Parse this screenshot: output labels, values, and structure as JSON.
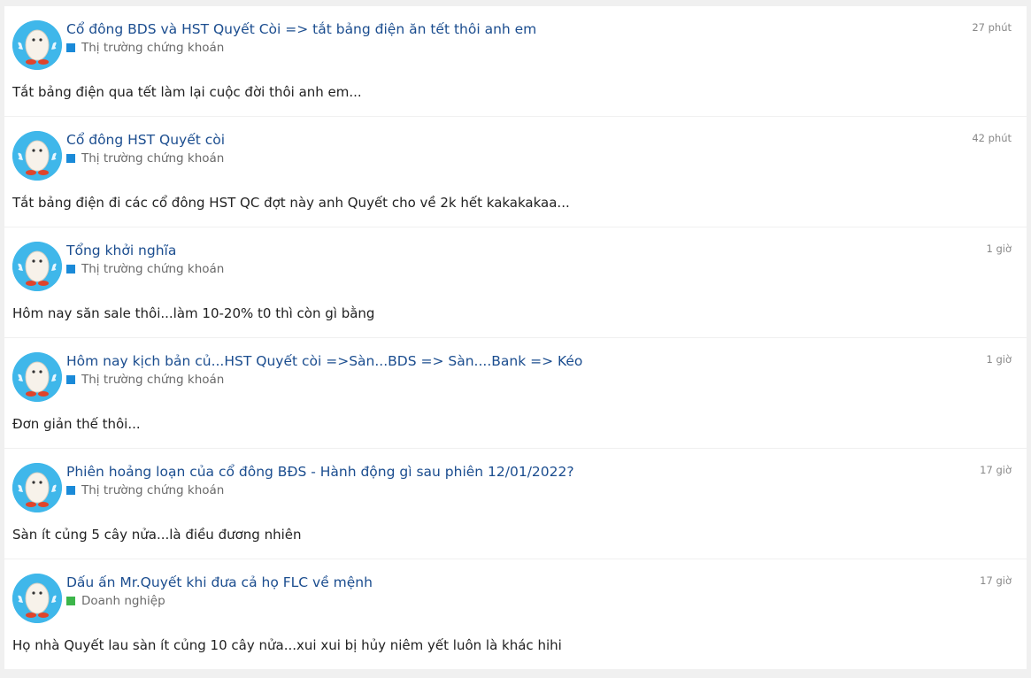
{
  "posts": [
    {
      "title": "Cổ đông BDS và HST Quyết Còi => tắt bảng điện ăn tết thôi anh em",
      "category": "Thị trường chứng khoán",
      "category_color": "#1a8ad8",
      "time": "27 phút",
      "snippet": "Tắt bảng điện qua tết làm lại cuộc đời thôi anh em..."
    },
    {
      "title": "Cổ đông HST Quyết còi",
      "category": "Thị trường chứng khoán",
      "category_color": "#1a8ad8",
      "time": "42 phút",
      "snippet": "Tắt bảng điện đi các cổ đông HST QC đợt này anh Quyết cho về 2k hết kakakakaa..."
    },
    {
      "title": "Tổng khởi nghĩa",
      "category": "Thị trường chứng khoán",
      "category_color": "#1a8ad8",
      "time": "1 giờ",
      "snippet": "Hôm nay săn sale thôi...làm 10-20% t0 thì còn gì bằng"
    },
    {
      "title": "Hôm nay kịch bản củ...HST Quyết còi =>Sàn...BDS => Sàn....Bank => Kéo",
      "category": "Thị trường chứng khoán",
      "category_color": "#1a8ad8",
      "time": "1 giờ",
      "snippet": "Đơn giản thế thôi..."
    },
    {
      "title": "Phiên hoảng loạn của cổ đông BĐS - Hành động gì sau phiên 12/01/2022?",
      "category": "Thị trường chứng khoán",
      "category_color": "#1a8ad8",
      "time": "17 giờ",
      "snippet": "Sàn ít củng 5 cây nửa...là điều đương nhiên"
    },
    {
      "title": "Dấu ấn Mr.Quyết khi đưa cả họ FLC về mệnh",
      "category": "Doanh nghiệp",
      "category_color": "#3cb54a",
      "time": "17 giờ",
      "snippet": "Họ nhà Quyết lau sàn ít củng 10 cây nửa...xui xui bị hủy niêm yết luôn là khác hihi"
    }
  ]
}
